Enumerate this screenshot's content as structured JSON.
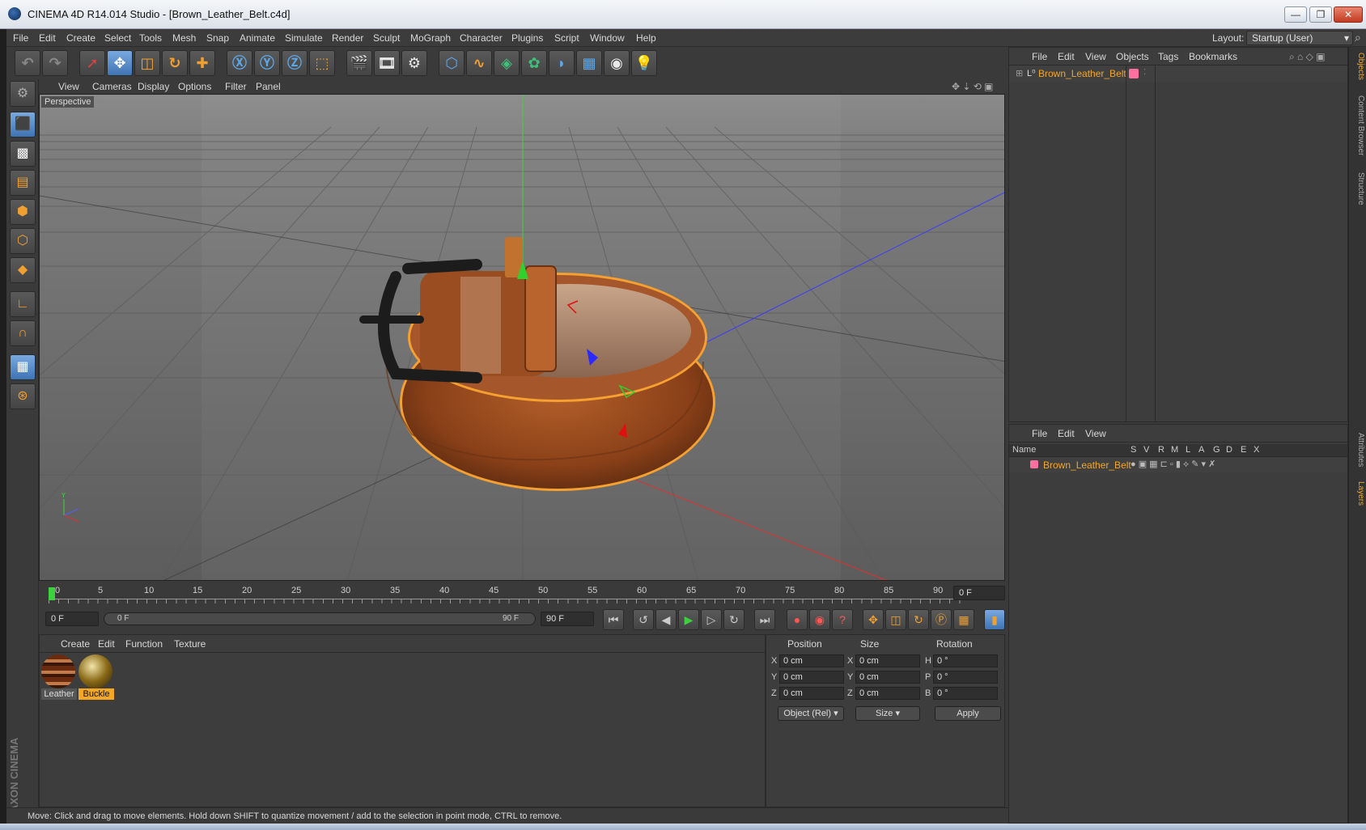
{
  "window": {
    "title": "CINEMA 4D R14.014 Studio - [Brown_Leather_Belt.c4d]",
    "min": "—",
    "restore": "❐",
    "close": "✕"
  },
  "menubar": {
    "items": [
      "File",
      "Edit",
      "Create",
      "Select",
      "Tools",
      "Mesh",
      "Snap",
      "Animate",
      "Simulate",
      "Render",
      "Sculpt",
      "MoGraph",
      "Character",
      "Plugins",
      "Script",
      "Window",
      "Help"
    ],
    "layout_label": "Layout:",
    "layout_value": "Startup (User)"
  },
  "viewport": {
    "menu": [
      "View",
      "Cameras",
      "Display",
      "Options",
      "Filter",
      "Panel"
    ],
    "label": "Perspective"
  },
  "timeline": {
    "ticks": [
      "0",
      "5",
      "10",
      "15",
      "20",
      "25",
      "30",
      "35",
      "40",
      "45",
      "50",
      "55",
      "60",
      "65",
      "70",
      "75",
      "80",
      "85",
      "90"
    ],
    "current_frame": "0 F",
    "start_frame": "0 F",
    "slider_start": "0 F",
    "slider_end": "90 F",
    "end_frame": "90 F"
  },
  "materials": {
    "menu": [
      "Create",
      "Edit",
      "Function",
      "Texture"
    ],
    "items": [
      {
        "label": "Leather"
      },
      {
        "label": "Buckle"
      }
    ]
  },
  "attributes": {
    "headers": {
      "position": "Position",
      "size": "Size",
      "rotation": "Rotation"
    },
    "axes_pos": [
      "X",
      "Y",
      "Z"
    ],
    "axes_rot": [
      "H",
      "P",
      "B"
    ],
    "position": [
      "0 cm",
      "0 cm",
      "0 cm"
    ],
    "size": [
      "0 cm",
      "0 cm",
      "0 cm"
    ],
    "rotation": [
      "0 °",
      "0 °",
      "0 °"
    ],
    "mode": "Object (Rel)",
    "size_mode": "Size",
    "apply": "Apply"
  },
  "objects": {
    "menu": [
      "File",
      "Edit",
      "View",
      "Objects",
      "Tags",
      "Bookmarks"
    ],
    "items": [
      {
        "name": "Brown_Leather_Belt"
      }
    ]
  },
  "layers": {
    "menu": [
      "File",
      "Edit",
      "View"
    ],
    "columns": [
      "Name",
      "S",
      "V",
      "R",
      "M",
      "L",
      "A",
      "G",
      "D",
      "E",
      "X"
    ],
    "items": [
      {
        "name": "Brown_Leather_Belt"
      }
    ]
  },
  "right_tabs": [
    "Objects",
    "Content Browser",
    "Structure",
    "Attributes",
    "Layers"
  ],
  "status": "Move: Click and drag to move elements. Hold down SHIFT to quantize movement / add to the selection in point mode, CTRL to remove.",
  "branding": "MAXON CINEMA 4D",
  "colors": {
    "accent": "#f5a623",
    "selected_tool": "#4a80c0",
    "layer_color": "#ff6fa0"
  }
}
